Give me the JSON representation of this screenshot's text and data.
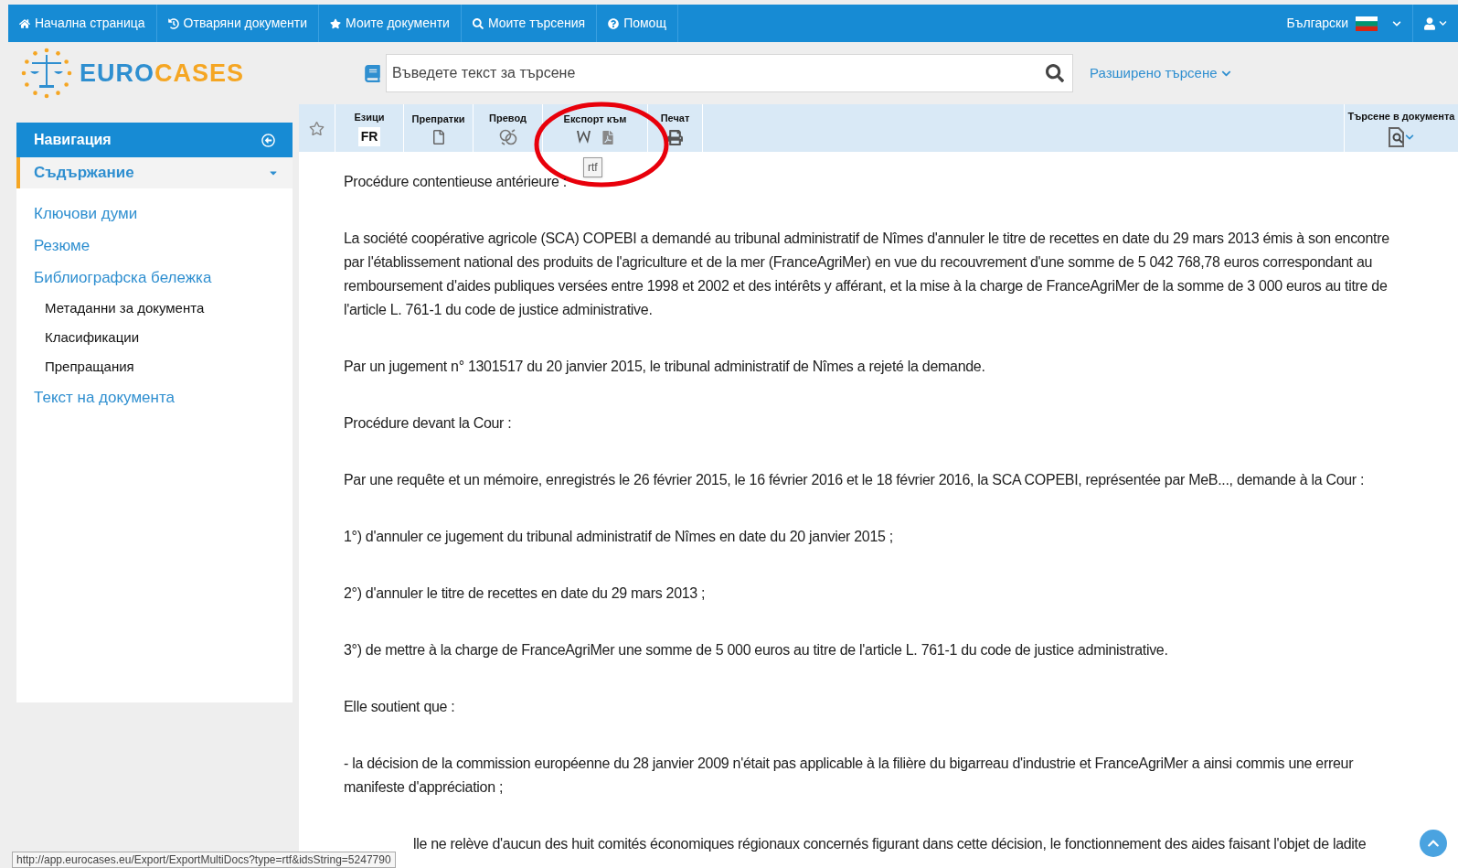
{
  "nav": {
    "items": [
      {
        "kind": "home",
        "label": "Начална страница"
      },
      {
        "kind": "history",
        "label": "Отваряни документи"
      },
      {
        "kind": "star",
        "label": "Моите документи"
      },
      {
        "kind": "search",
        "label": "Моите търсения"
      },
      {
        "kind": "help",
        "label": "Помощ"
      }
    ],
    "language": "Български"
  },
  "logo": {
    "part1": "EURO",
    "part2": "CASES"
  },
  "search": {
    "placeholder": "Въведете текст за търсене",
    "advanced": "Разширено търсене"
  },
  "sidebar": {
    "title": "Навигация",
    "section": "Съдържание",
    "items": [
      {
        "label": "Ключови думи"
      },
      {
        "label": "Резюме"
      },
      {
        "label": "Библиографска бележка",
        "children": [
          {
            "label": "Метаданни за документа"
          },
          {
            "label": "Класификации"
          },
          {
            "label": "Препращания"
          }
        ]
      },
      {
        "label": "Текст на документа"
      }
    ]
  },
  "toolbar": {
    "languages": {
      "label": "Езици",
      "value": "FR"
    },
    "references": "Препратки",
    "translation": "Превод",
    "export": "Експорт към",
    "print": "Печат",
    "search_in_document": "Търсене в документа",
    "tooltip": "rtf"
  },
  "paragraphs": [
    "Procédure contentieuse antérieure :",
    "La société coopérative agricole (SCA) COPEBI a demandé au tribunal administratif de Nîmes d'annuler le titre de recettes en date du 29 mars 2013 émis à son encontre par l'établissement national des produits de l'agriculture et de la mer (FranceAgriMer) en vue du recouvrement d'une somme de 5 042 768,78 euros correspondant au remboursement d'aides publiques versées entre 1998 et 2002 et des intérêts y afférant, et la mise à la charge de FranceAgriMer de la somme de 3 000 euros au titre de l'article L. 761-1 du code de justice administrative.",
    "Par un jugement n° 1301517 du 20 janvier 2015, le tribunal administratif de Nîmes a rejeté la demande.",
    "Procédure devant la Cour :",
    "Par une requête et un mémoire, enregistrés le 26 février 2015, le 16 février 2016 et le 18 février 2016, la SCA COPEBI, représentée par MeB..., demande à la Cour :",
    "1°) d'annuler ce jugement du tribunal administratif de Nîmes en date du 20 janvier 2015 ;",
    "2°) d'annuler le titre de recettes en date du 29 mars 2013 ;",
    "3°) de mettre à la charge de FranceAgriMer une somme de 5 000 euros au titre de l'article L. 761-1 du code de justice administrative.",
    "Elle soutient que :",
    "- la décision de la commission européenne du 28 janvier 2009 n'était pas applicable à la filière du bigarreau d'industrie et FranceAgriMer a ainsi commis une erreur manifeste d'appréciation ;"
  ],
  "partial_paragraph": "lle ne relève d'aucun des huit comités économiques régionaux concernés figurant dans cette décision, le fonctionnement des aides faisant l'objet de ladite",
  "status_url": "http://app.eurocases.eu/Export/ExportMultiDocs?type=rtf&idsString=5247790"
}
